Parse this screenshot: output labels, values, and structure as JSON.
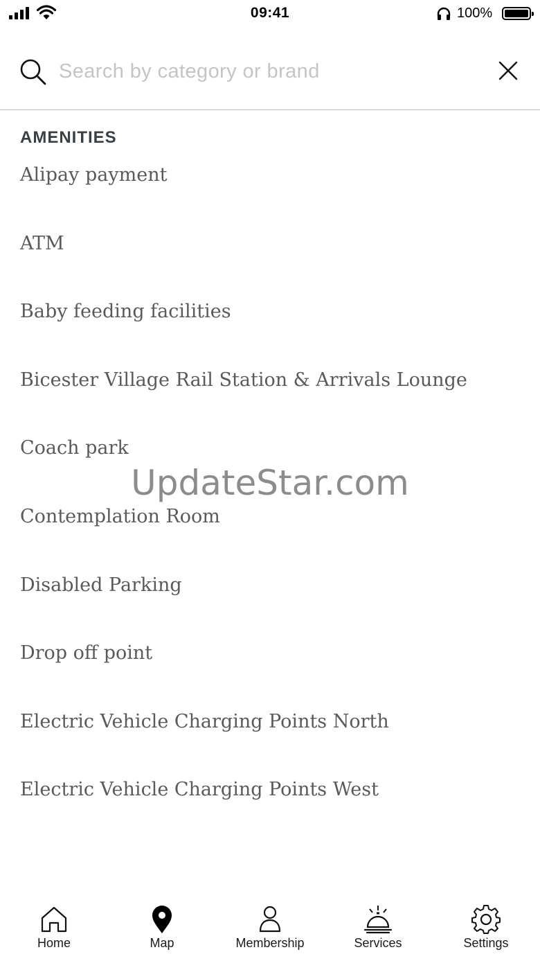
{
  "status_bar": {
    "time": "09:41",
    "battery_percent": "100%"
  },
  "search": {
    "placeholder": "Search by category or brand",
    "value": ""
  },
  "section": {
    "heading": "AMENITIES"
  },
  "amenities": [
    "Alipay payment",
    "ATM",
    "Baby feeding facilities",
    "Bicester Village Rail Station & Arrivals Lounge",
    "Coach park",
    "Contemplation Room",
    "Disabled Parking",
    "Drop off point",
    "Electric Vehicle Charging Points North",
    "Electric Vehicle Charging Points West"
  ],
  "watermark": "UpdateStar.com",
  "tabs": [
    {
      "label": "Home",
      "icon": "home-icon"
    },
    {
      "label": "Map",
      "icon": "map-pin-icon"
    },
    {
      "label": "Membership",
      "icon": "person-icon"
    },
    {
      "label": "Services",
      "icon": "concierge-bell-icon"
    },
    {
      "label": "Settings",
      "icon": "gear-icon"
    }
  ]
}
